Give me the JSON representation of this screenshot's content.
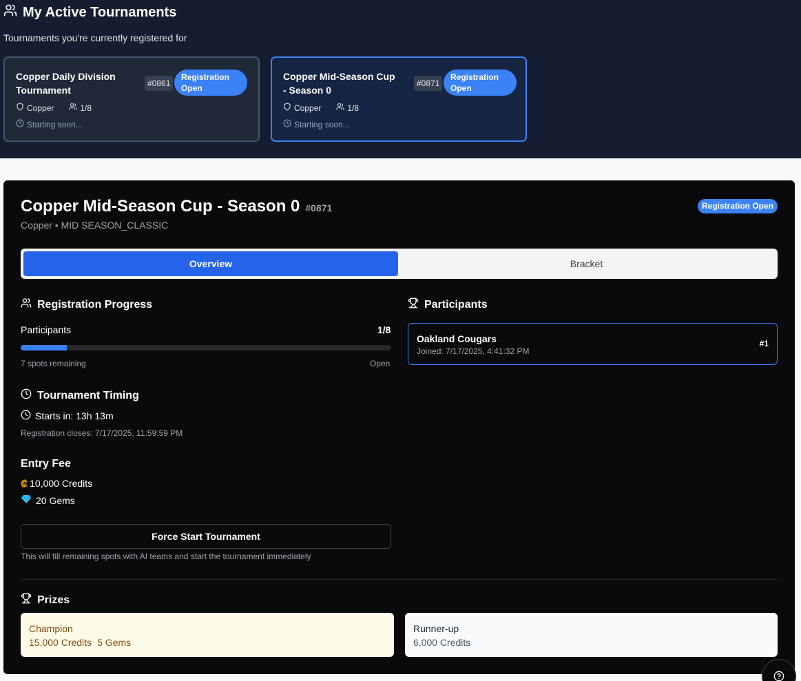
{
  "header": {
    "title": "My Active Tournaments",
    "subtitle": "Tournaments you're currently registered for"
  },
  "cards": [
    {
      "name": "Copper Daily Division Tournament",
      "id": "#0861",
      "status": "Registration Open",
      "division": "Copper",
      "participants": "1/8",
      "start": "Starting soon..."
    },
    {
      "name": "Copper Mid-Season Cup - Season 0",
      "id": "#0871",
      "status": "Registration Open",
      "division": "Copper",
      "participants": "1/8",
      "start": "Starting soon..."
    }
  ],
  "detail": {
    "title": "Copper Mid-Season Cup - Season 0",
    "id": "#0871",
    "subtitle": "Copper • MID SEASON_CLASSIC",
    "status": "Registration Open",
    "tabs": {
      "overview": "Overview",
      "bracket": "Bracket"
    },
    "registration": {
      "heading": "Registration Progress",
      "label": "Participants",
      "count": "1/8",
      "progress_fraction": 0.125,
      "remaining": "7 spots remaining",
      "state": "Open"
    },
    "timing": {
      "heading": "Tournament Timing",
      "starts": "Starts in: 13h 13m",
      "closes": "Registration closes: 7/17/2025, 11:59:59 PM"
    },
    "entry": {
      "heading": "Entry Fee",
      "credits_symbol": "₡",
      "credits": "10,000 Credits",
      "gems": "20 Gems"
    },
    "force_start": {
      "label": "Force Start Tournament",
      "note": "This will fill remaining spots with AI teams and start the tournament immediately"
    },
    "participants": {
      "heading": "Participants",
      "items": [
        {
          "name": "Oakland Cougars",
          "joined": "Joined: 7/17/2025, 4:41:32 PM",
          "rank": "#1"
        }
      ]
    },
    "prizes": {
      "heading": "Prizes",
      "champion": {
        "label": "Champion",
        "credits": "15,000 Credits",
        "gems": "5 Gems"
      },
      "runner_up": {
        "label": "Runner-up",
        "credits": "6,000 Credits"
      }
    }
  },
  "colors": {
    "accent": "#3b82f6",
    "tab_active": "#2563eb",
    "top_bg": "#151e30",
    "panel_bg": "#0a0a0c",
    "champion_bg": "#fefae8"
  },
  "icons": [
    "users-icon",
    "shield-icon",
    "clock-icon",
    "trophy-icon",
    "gem-icon",
    "help-icon"
  ]
}
